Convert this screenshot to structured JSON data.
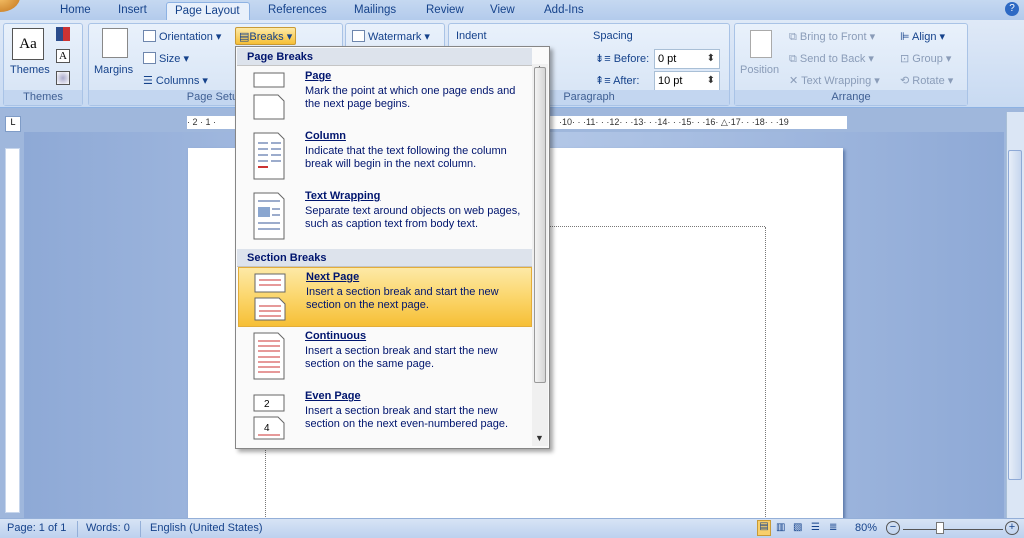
{
  "tabs": [
    "Home",
    "Insert",
    "Page Layout",
    "References",
    "Mailings",
    "Review",
    "View",
    "Add-Ins"
  ],
  "active_tab": "Page Layout",
  "ribbon": {
    "themes": {
      "label": "Themes",
      "group": "Themes"
    },
    "page_setup": {
      "margins": "Margins",
      "orientation": "Orientation",
      "size": "Size",
      "columns": "Columns",
      "breaks": "Breaks",
      "group": "Page Setup"
    },
    "background": {
      "watermark": "Watermark"
    },
    "paragraph": {
      "indent": "Indent",
      "spacing": "Spacing",
      "before_label": "Before:",
      "before_value": "0 pt",
      "after_label": "After:",
      "after_value": "10 pt",
      "group": "Paragraph"
    },
    "arrange": {
      "position": "Position",
      "bring_to_front": "Bring to Front",
      "send_to_back": "Send to Back",
      "text_wrapping": "Text Wrapping",
      "align": "Align",
      "group_btn": "Group",
      "rotate": "Rotate",
      "group": "Arrange"
    }
  },
  "ruler": {
    "left": "· 2 · 1 ·",
    "right": "·10· · ·11· · ·12· · ·13· · ·14· · ·15· · ·16· △·17· · ·18· · ·19"
  },
  "corner": "L",
  "breaks_menu": {
    "page_breaks_header": "Page Breaks",
    "section_breaks_header": "Section Breaks",
    "items": [
      {
        "title": "Page",
        "desc": "Mark the point at which one page ends and the next page begins."
      },
      {
        "title": "Column",
        "desc": "Indicate that the text following the column break will begin in the next column."
      },
      {
        "title": "Text Wrapping",
        "desc": "Separate text around objects on web pages, such as caption text from body text."
      },
      {
        "title": "Next Page",
        "desc": "Insert a section break and start the new section on the next page."
      },
      {
        "title": "Continuous",
        "desc": "Insert a section break and start the new section on the same page."
      },
      {
        "title": "Even Page",
        "desc": "Insert a section break and start the new section on the next even-numbered page."
      }
    ],
    "highlighted": "Next Page",
    "accent": "#f6bf36"
  },
  "status": {
    "page": "Page: 1 of 1",
    "words": "Words: 0",
    "language": "English (United States)",
    "zoom": "80%"
  }
}
